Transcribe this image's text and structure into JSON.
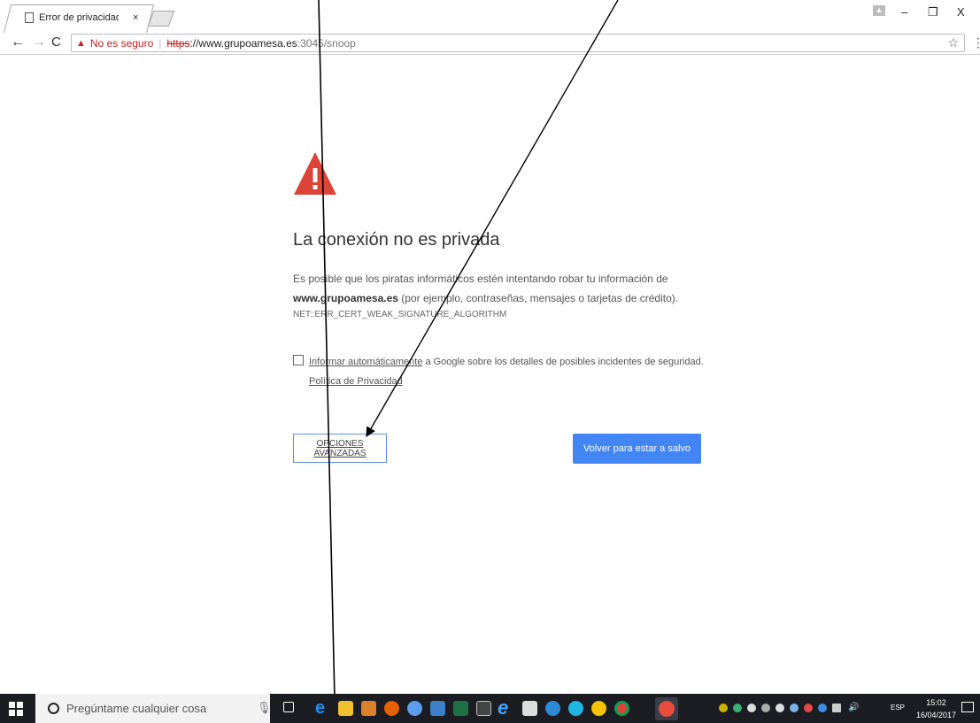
{
  "browser": {
    "tab_title": "Error de privacidad",
    "tab_close": "×",
    "window_min": "–",
    "window_max": "❐",
    "window_close": "X",
    "nav_back": "←",
    "nav_forward": "→",
    "nav_reload": "C",
    "star": "☆",
    "menu": "⋮"
  },
  "omnibox": {
    "insecure_label": "No es seguro",
    "separator": "|",
    "scheme": "https",
    "host_rest": "://www.grupoamesa.es",
    "path": ":3045/snoop"
  },
  "interstitial": {
    "heading": "La conexión no es privada",
    "explanation_line1": "Es posible que los piratas informáticos estén intentando robar tu información de",
    "explanation_domain": "www.grupoamesa.es",
    "explanation_line2": " (por ejemplo, contraseñas, mensajes o tarjetas de crédito).",
    "error_code": "NET::ERR_CERT_WEAK_SIGNATURE_ALGORITHM",
    "report_link": "Informar automáticamente",
    "report_text": " a Google sobre los detalles de posibles incidentes de seguridad. ",
    "privacy_link": "Política de Privacidad",
    "advanced_button": "OPCIONES AVANZADAS",
    "safety_button": "Volver para estar a salvo"
  },
  "taskbar": {
    "search_placeholder": "Pregúntame cualquier cosa",
    "language": "ESP",
    "time": "15:02",
    "date": "16/04/2017"
  },
  "colors": {
    "danger": "#c5221f",
    "primary_button": "#4285f4",
    "taskbar": "#1b1d22"
  }
}
